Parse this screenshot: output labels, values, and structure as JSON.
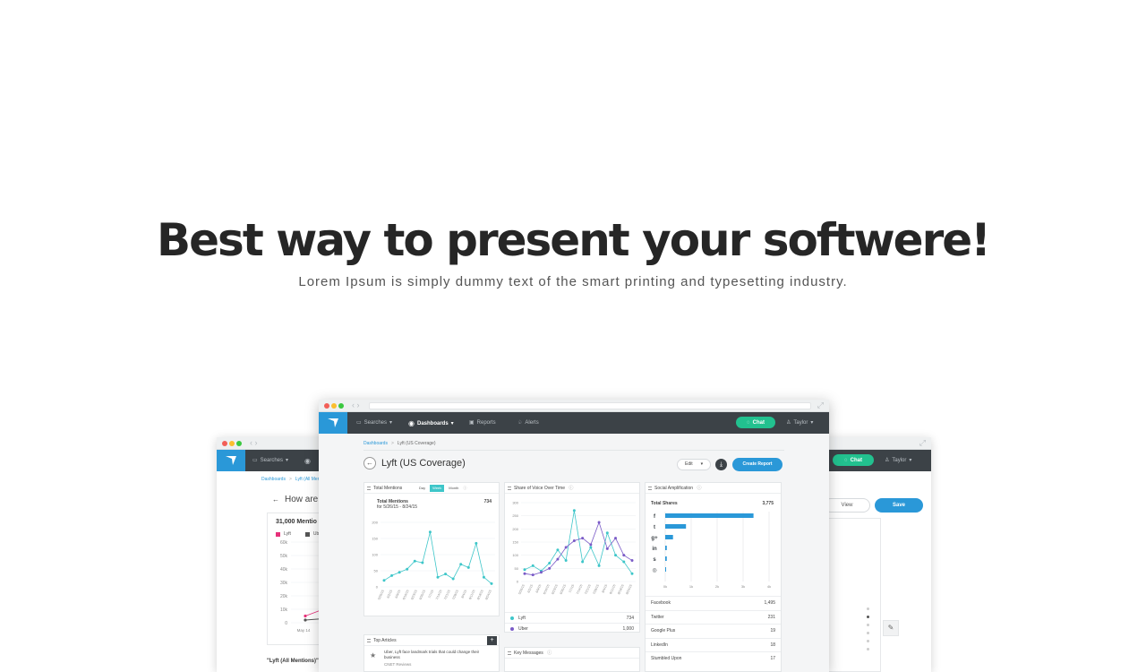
{
  "hero": {
    "title": "Best way to present your softwere!",
    "subtitle": "Lorem Ipsum is simply dummy text of the smart printing and typesetting industry."
  },
  "colors": {
    "brand_blue": "#2a98d8",
    "nav_dark": "#3c4247",
    "chat_green": "#22c18f",
    "series_teal": "#3ec6c9",
    "series_purple": "#7a5bc7"
  },
  "main_app": {
    "nav": {
      "searches": "Searches",
      "dashboards": "Dashboards",
      "reports": "Reports",
      "alerts": "Alerts",
      "chat": "Chat",
      "user": "Taylor"
    },
    "breadcrumb": {
      "root": "Dashboards",
      "current": "Lyft (US Coverage)"
    },
    "page_title": "Lyft (US Coverage)",
    "edit_label": "Edit",
    "create_report_label": "Create Report",
    "total_mentions": {
      "title": "Total Mentions",
      "tabs": [
        "Day",
        "Week",
        "Month"
      ],
      "active_tab": "Week",
      "summary_label": "Total Mentions",
      "summary_range": "for 5/26/15 - 8/24/15",
      "summary_value": "734"
    },
    "share_of_voice": {
      "title": "Share of Voice Over Time",
      "legend": [
        {
          "name": "Lyft",
          "value": "734"
        },
        {
          "name": "Uber",
          "value": "1,000"
        }
      ]
    },
    "social": {
      "title": "Social Amplification",
      "total_label": "Total Shares",
      "total_value": "3,775",
      "networks": [
        {
          "name": "Facebook",
          "icon": "facebook-icon",
          "value": "1,495"
        },
        {
          "name": "Twitter",
          "icon": "twitter-icon",
          "value": "231"
        },
        {
          "name": "Google Plus",
          "icon": "google-plus-icon",
          "value": "19"
        },
        {
          "name": "LinkedIn",
          "icon": "linkedin-icon",
          "value": "18"
        },
        {
          "name": "Stumbled Upon",
          "icon": "stumbleupon-icon",
          "value": "17"
        }
      ]
    },
    "top_articles": {
      "title": "Top Articles",
      "article_text": "Uber, Lyft face landmark trials that could change their business",
      "article_source": "CNET Reviews"
    },
    "key_messages": {
      "title": "Key Messages"
    }
  },
  "left_app": {
    "nav": {
      "searches": "Searches"
    },
    "breadcrumb": {
      "root": "Dashboards",
      "current": "Lyft (All Mentio"
    },
    "heading": "How are",
    "chart_title": "31,000 Mentio",
    "legend": [
      "Lyft",
      "Ub"
    ],
    "footer": "\"Lyft (All Mentions)\""
  },
  "right_app": {
    "chat": "Chat",
    "user": "Taylor",
    "view_label": "View",
    "save_label": "Save"
  },
  "chart_data": [
    {
      "type": "line",
      "title": "Total Mentions",
      "ylim": [
        0,
        200
      ],
      "yticks": [
        "200",
        "150",
        "100",
        "50",
        "0"
      ],
      "x": [
        "5/26/15",
        "6/2/15",
        "6/9/15",
        "6/16/15",
        "6/23/15",
        "6/30/15",
        "7/7/15",
        "7/14/15",
        "7/21/15",
        "7/28/15",
        "8/4/15",
        "8/11/15",
        "8/18/15",
        "8/24/15"
      ],
      "series": [
        {
          "name": "",
          "values": [
            20,
            35,
            45,
            55,
            80,
            75,
            170,
            30,
            40,
            25,
            70,
            60,
            135,
            30,
            10
          ]
        }
      ]
    },
    {
      "type": "line",
      "title": "Share of Voice Over Time",
      "ylim": [
        0,
        300
      ],
      "yticks": [
        "300",
        "250",
        "200",
        "150",
        "100",
        "50",
        "0"
      ],
      "x": [
        "5/26/15",
        "6/2/15",
        "6/9/15",
        "6/16/15",
        "6/23/15",
        "6/30/15",
        "7/7/15",
        "7/14/15",
        "7/21/15",
        "7/28/15",
        "8/4/15",
        "8/11/15",
        "8/18/15",
        "8/24/15"
      ],
      "series": [
        {
          "name": "Lyft",
          "values": [
            45,
            60,
            40,
            70,
            120,
            80,
            270,
            75,
            130,
            60,
            185,
            100,
            75,
            30
          ]
        },
        {
          "name": "Uber",
          "values": [
            30,
            25,
            35,
            50,
            85,
            130,
            155,
            165,
            140,
            225,
            125,
            165,
            100,
            80
          ]
        }
      ]
    },
    {
      "type": "bar",
      "title": "Social Amplification",
      "categories": [
        "Facebook",
        "Twitter",
        "Google Plus",
        "LinkedIn",
        "Stumbled Upon",
        "Other"
      ],
      "values": [
        3400,
        800,
        300,
        60,
        60,
        20
      ],
      "xticks": [
        "0k",
        "1k",
        "2k",
        "3k",
        "4k"
      ],
      "xlim": [
        0,
        4000
      ]
    },
    {
      "type": "line",
      "title": "31,000 Mentio",
      "yticks": [
        "60k",
        "50k",
        "40k",
        "30k",
        "20k",
        "10k",
        "0"
      ],
      "ylim": [
        0,
        60000
      ],
      "x": [
        "May 14"
      ],
      "series": [
        {
          "name": "Lyft",
          "values": [
            5000,
            10000
          ]
        },
        {
          "name": "Ub",
          "values": [
            2000,
            3000
          ]
        }
      ]
    }
  ]
}
